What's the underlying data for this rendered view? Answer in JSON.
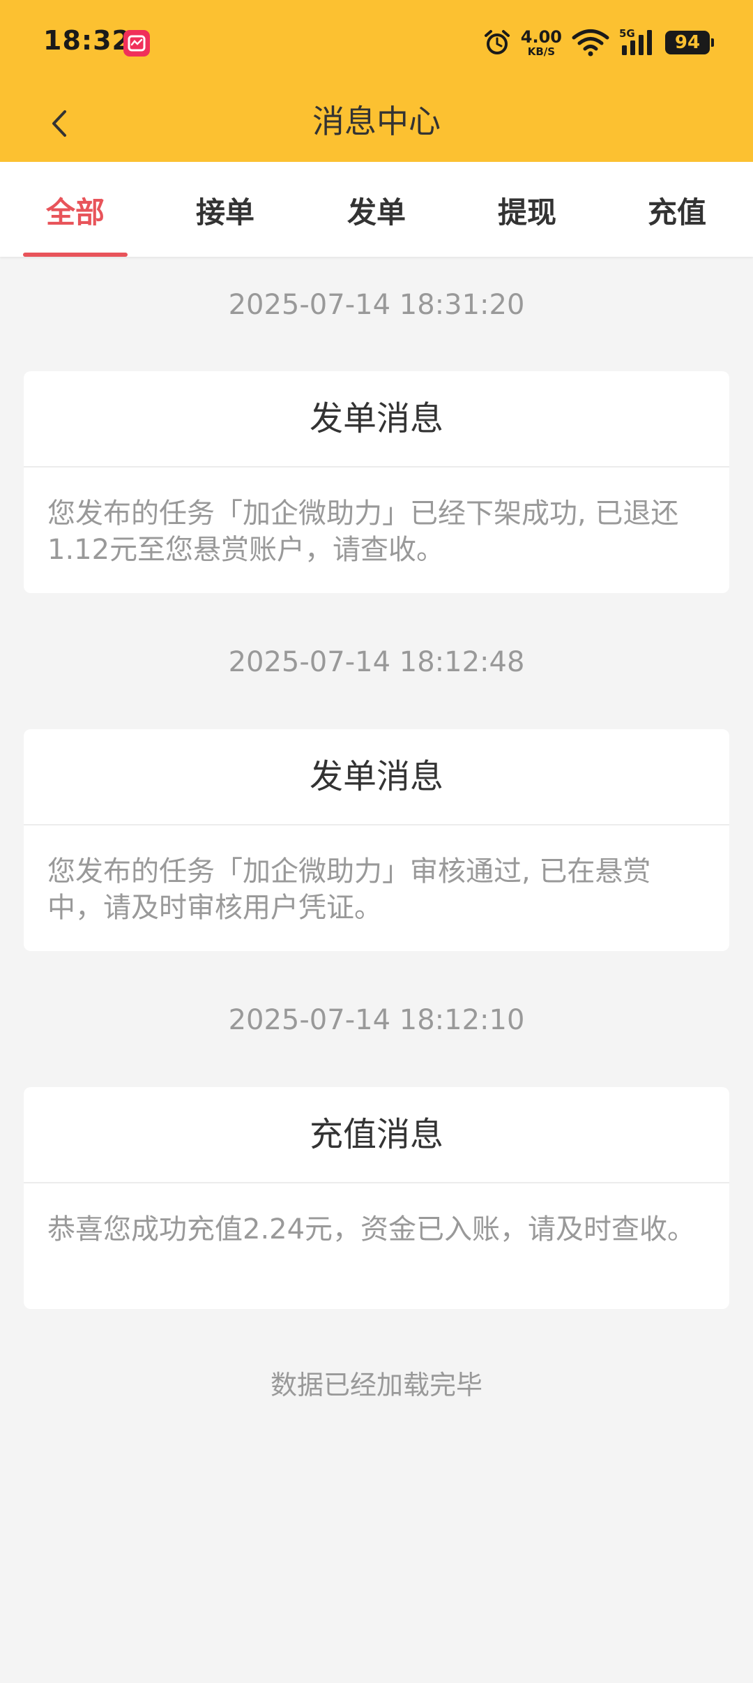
{
  "status_bar": {
    "time": "18:32",
    "net_speed_value": "4.00",
    "net_speed_unit": "KB/S",
    "network_type": "5G",
    "battery": "94"
  },
  "nav": {
    "title": "消息中心"
  },
  "tabs": [
    {
      "label": "全部",
      "active": true
    },
    {
      "label": "接单",
      "active": false
    },
    {
      "label": "发单",
      "active": false
    },
    {
      "label": "提现",
      "active": false
    },
    {
      "label": "充值",
      "active": false
    }
  ],
  "messages": [
    {
      "time": "2025-07-14 18:31:20",
      "title": "发单消息",
      "body": "您发布的任务「加企微助力」已经下架成功, 已退还1.12元至您悬赏账户，请查收。"
    },
    {
      "time": "2025-07-14 18:12:48",
      "title": "发单消息",
      "body": "您发布的任务「加企微助力」审核通过, 已在悬赏中，请及时审核用户凭证。"
    },
    {
      "time": "2025-07-14 18:12:10",
      "title": "充值消息",
      "body": "恭喜您成功充值2.24元，资金已入账，请及时查收。"
    }
  ],
  "footer": {
    "text": "数据已经加载完毕"
  },
  "colors": {
    "header_bg": "#fcc131",
    "accent": "#e8545a",
    "page_bg": "#f4f4f4"
  }
}
